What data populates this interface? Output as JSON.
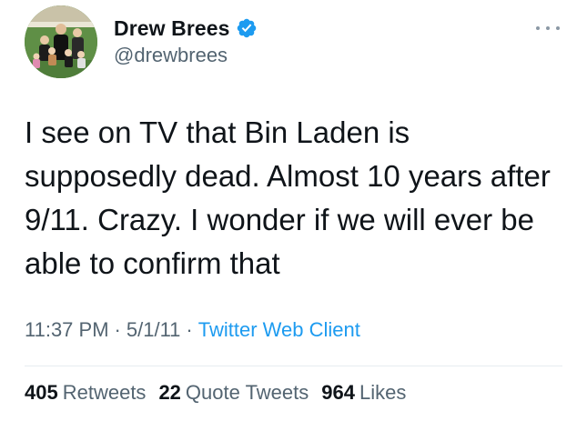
{
  "author": {
    "display_name": "Drew Brees",
    "handle": "@drewbrees",
    "verified": true,
    "verified_color": "#1d9bf0",
    "avatar_icon": "family-photo-avatar"
  },
  "tweet": {
    "text": "I see on TV that Bin Laden is supposedly dead. Almost 10 years after 9/11. Crazy. I wonder if we will ever be able to confirm that",
    "time": "11:37 PM",
    "date": "5/1/11",
    "separator": "·",
    "source": "Twitter Web Client"
  },
  "stats": {
    "retweets_count": "405",
    "retweets_label": "Retweets",
    "quotes_count": "22",
    "quotes_label": "Quote Tweets",
    "likes_count": "964",
    "likes_label": "Likes"
  },
  "colors": {
    "text": "#0f1419",
    "secondary": "#536471",
    "link": "#1d9bf0",
    "divider": "#e6ecf0"
  },
  "icons": {
    "more": "more-options-icon",
    "verified": "verified-badge-icon"
  }
}
